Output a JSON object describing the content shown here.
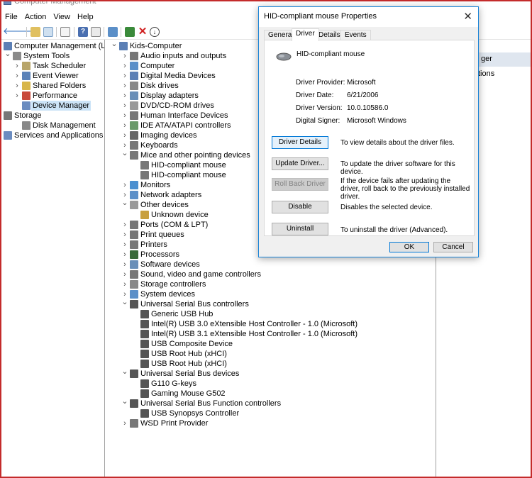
{
  "window": {
    "title": "Computer Management"
  },
  "menu": [
    "File",
    "Action",
    "View",
    "Help"
  ],
  "left_tree": [
    {
      "label": "Computer Management (Local",
      "depth": 0,
      "chev": "",
      "icon": "computer-management-icon",
      "color": "#5b7fb5"
    },
    {
      "label": "System Tools",
      "depth": 1,
      "chev": "v",
      "icon": "system-tools-icon",
      "color": "#8a8a8a"
    },
    {
      "label": "Task Scheduler",
      "depth": 2,
      "chev": ">",
      "icon": "task-scheduler-icon",
      "color": "#b8a56a"
    },
    {
      "label": "Event Viewer",
      "depth": 2,
      "chev": ">",
      "icon": "event-viewer-icon",
      "color": "#5a82b8"
    },
    {
      "label": "Shared Folders",
      "depth": 2,
      "chev": ">",
      "icon": "shared-folders-icon",
      "color": "#d8b64a"
    },
    {
      "label": "Performance",
      "depth": 2,
      "chev": ">",
      "icon": "performance-icon",
      "color": "#c94a3c"
    },
    {
      "label": "Device Manager",
      "depth": 2,
      "chev": "",
      "icon": "device-manager-icon",
      "color": "#6b8cc0",
      "selected": true
    },
    {
      "label": "Storage",
      "depth": 0,
      "chev": "v",
      "icon": "storage-icon",
      "color": "#777"
    },
    {
      "label": "Disk Management",
      "depth": 2,
      "chev": "",
      "icon": "disk-management-icon",
      "color": "#888"
    },
    {
      "label": "Services and Applications",
      "depth": 0,
      "chev": ">",
      "icon": "services-icon",
      "color": "#6b8cc0"
    }
  ],
  "device_tree": [
    {
      "label": "Kids-Computer",
      "depth": 0,
      "chev": "v",
      "icon": "computer-icon",
      "color": "#5b7fb5"
    },
    {
      "label": "Audio inputs and outputs",
      "depth": 1,
      "chev": ">",
      "icon": "speaker-icon",
      "color": "#777"
    },
    {
      "label": "Computer",
      "depth": 1,
      "chev": ">",
      "icon": "computer-icon",
      "color": "#5b8fc8"
    },
    {
      "label": "Digital Media Devices",
      "depth": 1,
      "chev": ">",
      "icon": "media-device-icon",
      "color": "#5b7fb5"
    },
    {
      "label": "Disk drives",
      "depth": 1,
      "chev": ">",
      "icon": "disk-drive-icon",
      "color": "#888"
    },
    {
      "label": "Display adapters",
      "depth": 1,
      "chev": ">",
      "icon": "display-adapter-icon",
      "color": "#6a8fb8"
    },
    {
      "label": "DVD/CD-ROM drives",
      "depth": 1,
      "chev": ">",
      "icon": "dvd-drive-icon",
      "color": "#999"
    },
    {
      "label": "Human Interface Devices",
      "depth": 1,
      "chev": ">",
      "icon": "hid-icon",
      "color": "#777"
    },
    {
      "label": "IDE ATA/ATAPI controllers",
      "depth": 1,
      "chev": ">",
      "icon": "ide-controller-icon",
      "color": "#6a9a6a"
    },
    {
      "label": "Imaging devices",
      "depth": 1,
      "chev": ">",
      "icon": "camera-icon",
      "color": "#666"
    },
    {
      "label": "Keyboards",
      "depth": 1,
      "chev": ">",
      "icon": "keyboard-icon",
      "color": "#777"
    },
    {
      "label": "Mice and other pointing devices",
      "depth": 1,
      "chev": "v",
      "icon": "mouse-icon",
      "color": "#777"
    },
    {
      "label": "HID-compliant mouse",
      "depth": 2,
      "chev": "",
      "icon": "mouse-icon",
      "color": "#777"
    },
    {
      "label": "HID-compliant mouse",
      "depth": 2,
      "chev": "",
      "icon": "mouse-icon",
      "color": "#777"
    },
    {
      "label": "Monitors",
      "depth": 1,
      "chev": ">",
      "icon": "monitor-icon",
      "color": "#4a8fd0"
    },
    {
      "label": "Network adapters",
      "depth": 1,
      "chev": ">",
      "icon": "network-icon",
      "color": "#5b8fc8"
    },
    {
      "label": "Other devices",
      "depth": 1,
      "chev": "v",
      "icon": "unknown-device-icon",
      "color": "#999"
    },
    {
      "label": "Unknown device",
      "depth": 2,
      "chev": "",
      "icon": "warning-device-icon",
      "color": "#c8a040"
    },
    {
      "label": "Ports (COM & LPT)",
      "depth": 1,
      "chev": ">",
      "icon": "port-icon",
      "color": "#777"
    },
    {
      "label": "Print queues",
      "depth": 1,
      "chev": ">",
      "icon": "print-queue-icon",
      "color": "#777"
    },
    {
      "label": "Printers",
      "depth": 1,
      "chev": ">",
      "icon": "printer-icon",
      "color": "#777"
    },
    {
      "label": "Processors",
      "depth": 1,
      "chev": ">",
      "icon": "processor-icon",
      "color": "#3a6a3a"
    },
    {
      "label": "Software devices",
      "depth": 1,
      "chev": ">",
      "icon": "software-device-icon",
      "color": "#6a8fb8"
    },
    {
      "label": "Sound, video and game controllers",
      "depth": 1,
      "chev": ">",
      "icon": "speaker-icon",
      "color": "#777"
    },
    {
      "label": "Storage controllers",
      "depth": 1,
      "chev": ">",
      "icon": "storage-controller-icon",
      "color": "#888"
    },
    {
      "label": "System devices",
      "depth": 1,
      "chev": ">",
      "icon": "system-device-icon",
      "color": "#5b8fc8"
    },
    {
      "label": "Universal Serial Bus controllers",
      "depth": 1,
      "chev": "v",
      "icon": "usb-icon",
      "color": "#555"
    },
    {
      "label": "Generic USB Hub",
      "depth": 2,
      "chev": "",
      "icon": "usb-icon",
      "color": "#555"
    },
    {
      "label": "Intel(R) USB 3.0 eXtensible Host Controller - 1.0 (Microsoft)",
      "depth": 2,
      "chev": "",
      "icon": "usb-icon",
      "color": "#555"
    },
    {
      "label": "Intel(R) USB 3.1 eXtensible Host Controller - 1.0 (Microsoft)",
      "depth": 2,
      "chev": "",
      "icon": "usb-icon",
      "color": "#555"
    },
    {
      "label": "USB Composite Device",
      "depth": 2,
      "chev": "",
      "icon": "usb-icon",
      "color": "#555"
    },
    {
      "label": "USB Root Hub (xHCI)",
      "depth": 2,
      "chev": "",
      "icon": "usb-icon",
      "color": "#555"
    },
    {
      "label": "USB Root Hub (xHCI)",
      "depth": 2,
      "chev": "",
      "icon": "usb-icon",
      "color": "#555"
    },
    {
      "label": "Universal Serial Bus devices",
      "depth": 1,
      "chev": "v",
      "icon": "usb-icon",
      "color": "#555"
    },
    {
      "label": "G110 G-keys",
      "depth": 2,
      "chev": "",
      "icon": "usb-icon",
      "color": "#555"
    },
    {
      "label": "Gaming Mouse G502",
      "depth": 2,
      "chev": "",
      "icon": "usb-icon",
      "color": "#555"
    },
    {
      "label": "Universal Serial Bus Function controllers",
      "depth": 1,
      "chev": "v",
      "icon": "usb-icon",
      "color": "#555"
    },
    {
      "label": "USB Synopsys Controller",
      "depth": 2,
      "chev": "",
      "icon": "usb-icon",
      "color": "#555"
    },
    {
      "label": "WSD Print Provider",
      "depth": 1,
      "chev": ">",
      "icon": "print-provider-icon",
      "color": "#777"
    }
  ],
  "actions": {
    "header": "Device Manager",
    "header_visible": "ger",
    "item_visible": "tions"
  },
  "dialog": {
    "title": "HID-compliant mouse Properties",
    "close_glyph": "✕",
    "tabs": [
      "General",
      "Driver",
      "Details",
      "Events"
    ],
    "active_tab": "Driver",
    "device_name": "HID-compliant mouse",
    "fields": [
      {
        "key": "Driver Provider:",
        "value": "Microsoft"
      },
      {
        "key": "Driver Date:",
        "value": "6/21/2006"
      },
      {
        "key": "Driver Version:",
        "value": "10.0.10586.0"
      },
      {
        "key": "Digital Signer:",
        "value": "Microsoft Windows"
      }
    ],
    "buttons": [
      {
        "label": "Driver Details",
        "desc": "To view details about the driver files.",
        "state": "focus"
      },
      {
        "label": "Update Driver...",
        "desc": "To update the driver software for this device.",
        "state": "normal"
      },
      {
        "label": "Roll Back Driver",
        "desc": "If the device fails after updating the driver, roll back to the previously installed driver.",
        "state": "disabled"
      },
      {
        "label": "Disable",
        "desc": "Disables the selected device.",
        "state": "normal"
      },
      {
        "label": "Uninstall",
        "desc": "To uninstall the driver (Advanced).",
        "state": "normal"
      }
    ],
    "ok_label": "OK",
    "cancel_label": "Cancel"
  }
}
